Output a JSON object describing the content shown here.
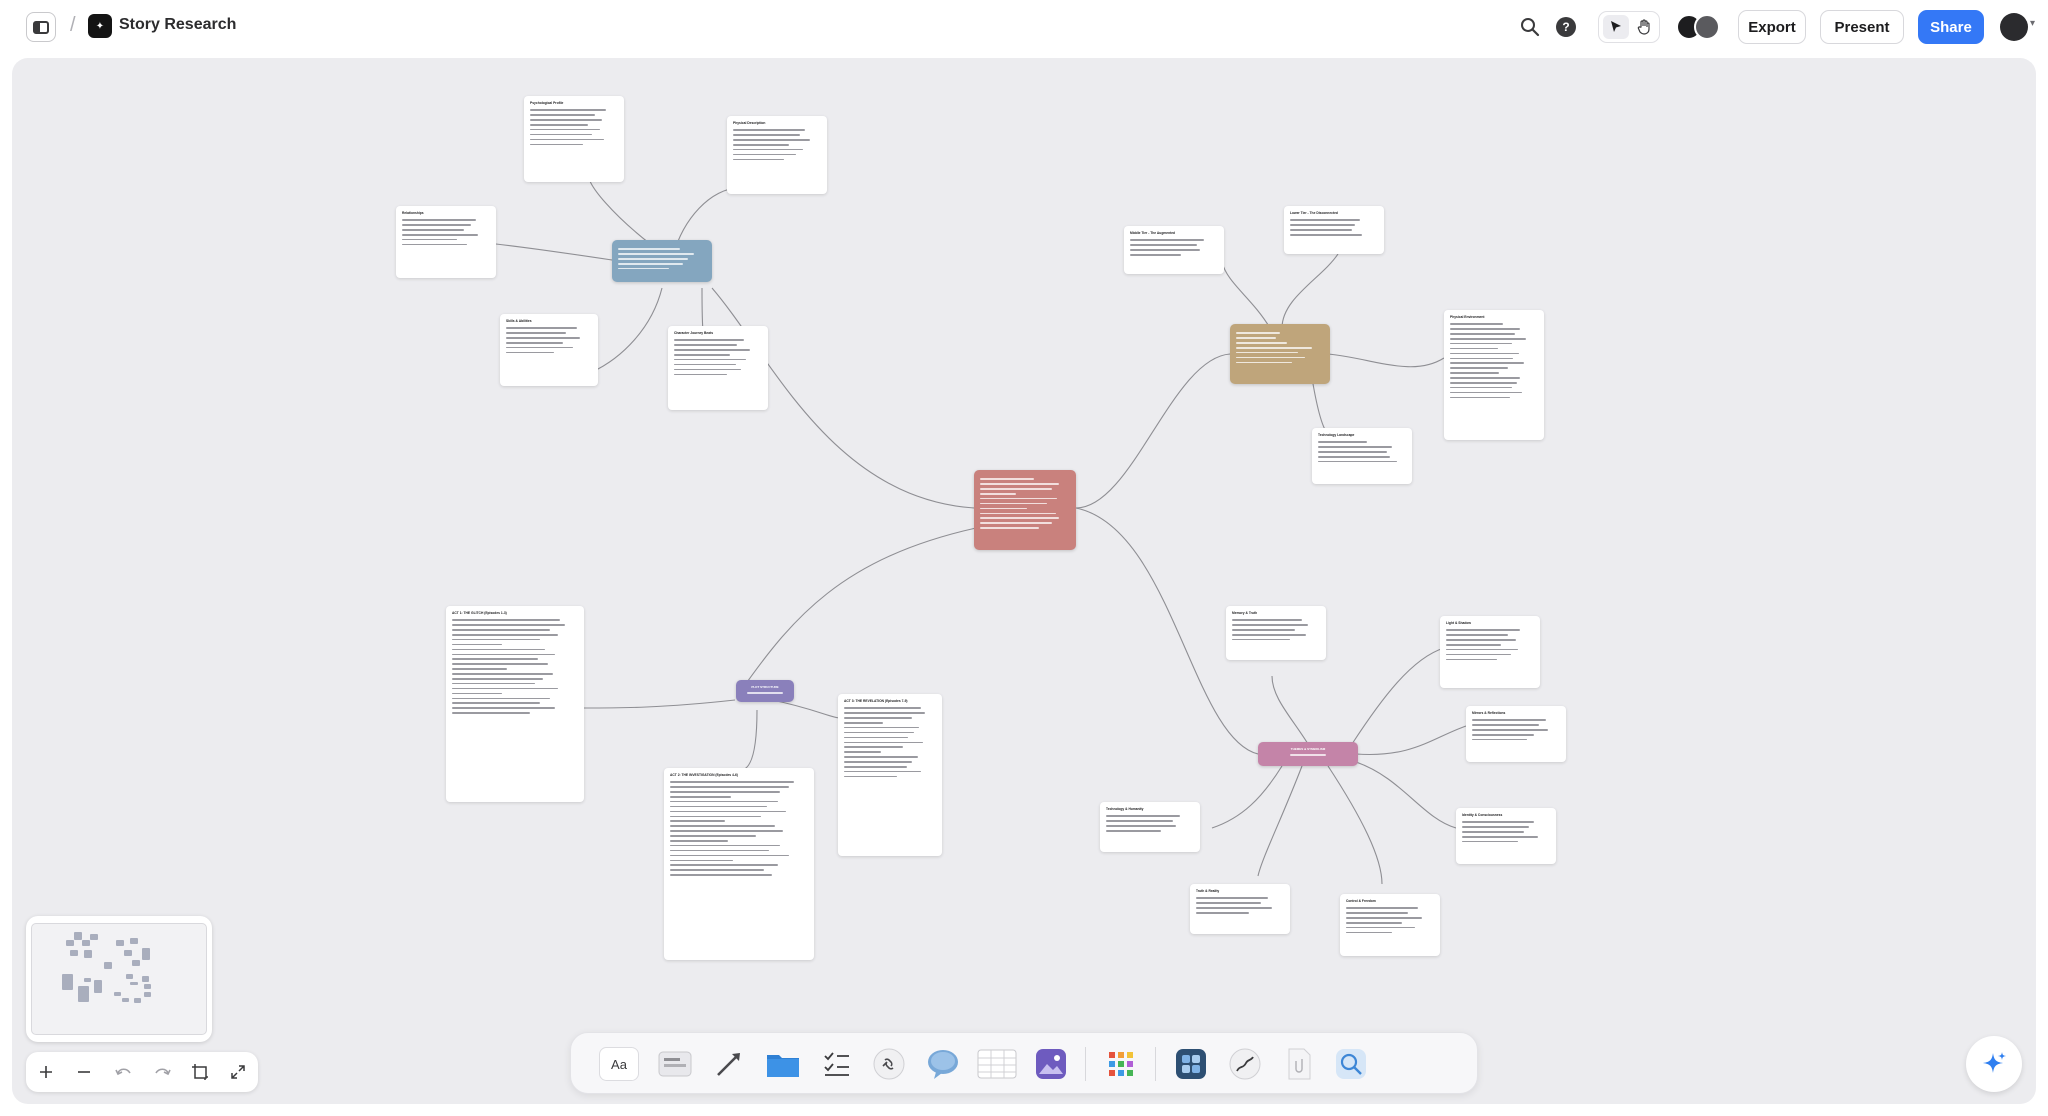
{
  "app": {
    "doc_title": "Story Research"
  },
  "toolbar": {
    "export_label": "Export",
    "present_label": "Present",
    "share_label": "Share",
    "help_glyph": "?"
  },
  "colors": {
    "accent": "#3478f6",
    "canvas": "#ececef",
    "hub_blue": "#84a6bf",
    "hub_tan": "#bfa57b",
    "hub_red": "#c9817d",
    "hub_purple": "#8a80bb",
    "hub_pink": "#c484a8"
  },
  "icons": [
    "sidebar-toggle-icon",
    "search-icon",
    "help-icon",
    "pointer-icon",
    "hand-icon",
    "chevron-down-icon",
    "plus-icon",
    "minus-icon",
    "undo-icon",
    "redo-icon",
    "fit-icon",
    "expand-icon",
    "sparkle-icon"
  ],
  "nodes": {
    "psych": {
      "title": "Psychological Profile"
    },
    "phys_desc": {
      "title": "Physical Description"
    },
    "relationships": {
      "title": "Relationships"
    },
    "skills": {
      "title": "Skills & Abilities"
    },
    "character_journey": {
      "title": "Character Journey Beats"
    },
    "middle_tier": {
      "title": "Middle Tier - The Augmented"
    },
    "lower_tier": {
      "title": "Lower Tier - The Disconnected"
    },
    "phys_env": {
      "title": "Physical Environment"
    },
    "tech_landscape": {
      "title": "Technology Landscape"
    },
    "act1": {
      "title": "ACT 1: THE GLITCH (Episodes 1-3)"
    },
    "act2": {
      "title": "ACT 2: THE INVESTIGATION (Episodes 4-6)"
    },
    "act3": {
      "title": "ACT 3: THE REVELATION (Episodes 7-9)"
    },
    "memory": {
      "title": "Memory & Truth"
    },
    "light": {
      "title": "Light & Shadow"
    },
    "mirrors": {
      "title": "Mirrors & Reflections"
    },
    "identity": {
      "title": "Identity & Consciousness"
    },
    "tech_humanity": {
      "title": "Technology & Humanity"
    },
    "truth": {
      "title": "Truth & Reality"
    },
    "control": {
      "title": "Control & Freedom"
    },
    "hub_plot": {
      "title": "PLOT STRUCTURE"
    },
    "hub_themes": {
      "title": "THEMES & SYMBOLISM"
    }
  }
}
